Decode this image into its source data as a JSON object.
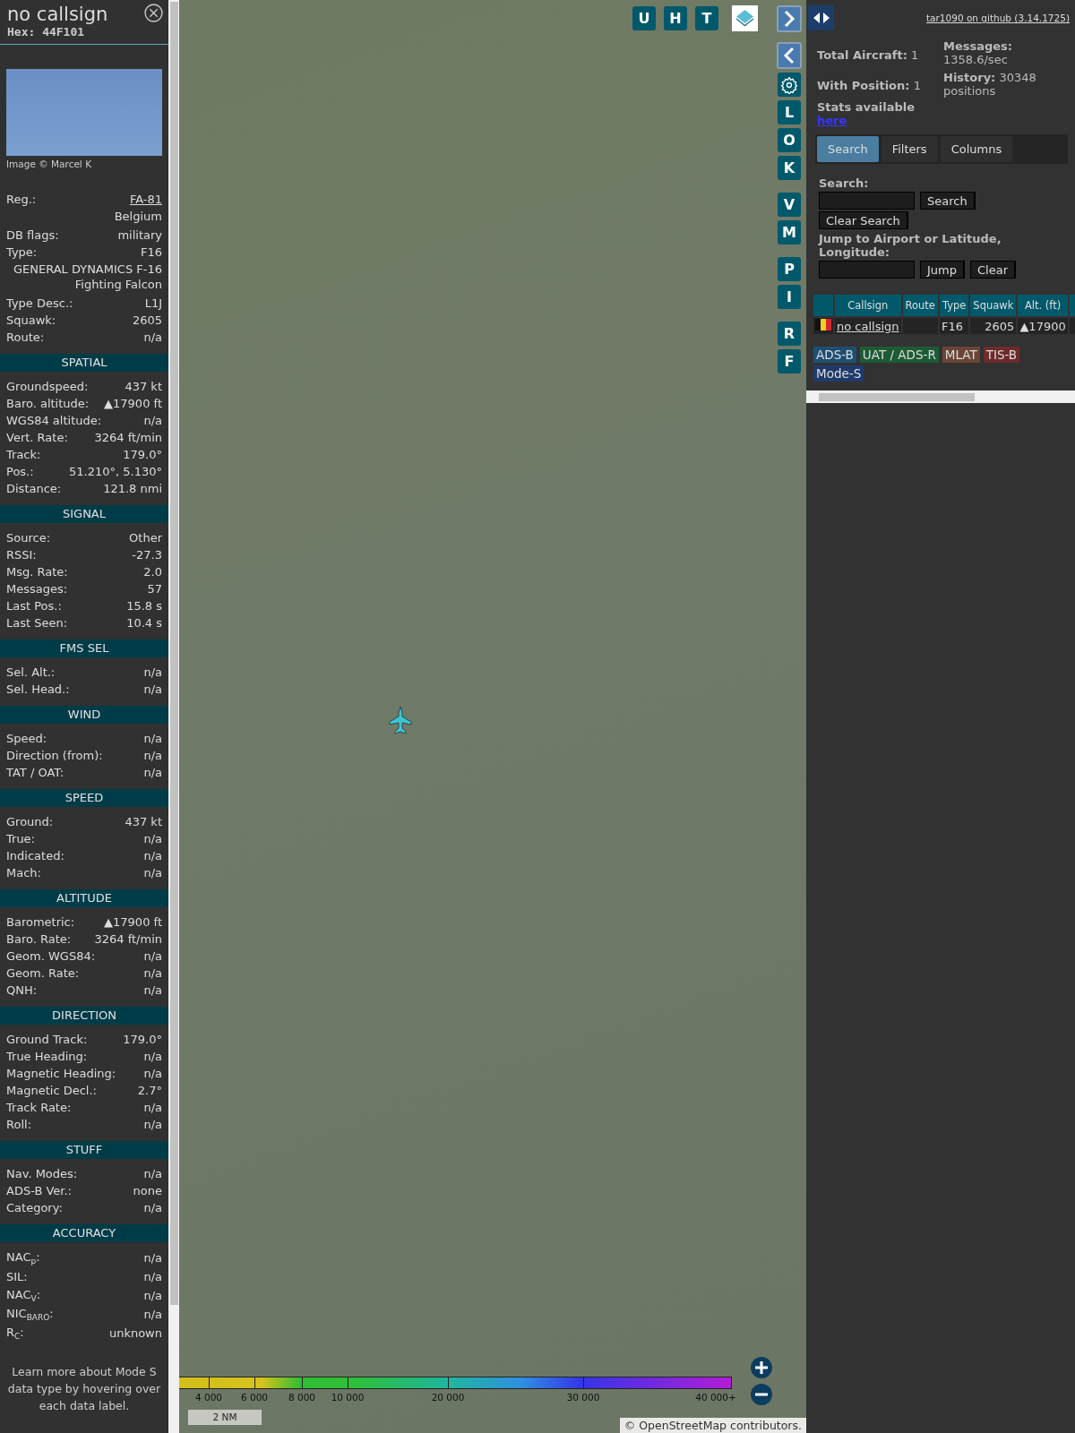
{
  "sidebar": {
    "title": "no callsign",
    "hex": "Hex: 44F101",
    "image_credit": "Image © Marcel K",
    "identity": [
      {
        "kind": "link",
        "label": "Reg.:",
        "value": "FA-81"
      },
      {
        "kind": "value",
        "value": "Belgium"
      },
      {
        "kind": "row",
        "label": "DB flags:",
        "value": "military"
      },
      {
        "kind": "row",
        "label": "Type:",
        "value": "F16"
      },
      {
        "kind": "value",
        "value": "GENERAL DYNAMICS F-16 Fighting Falcon"
      },
      {
        "kind": "row",
        "label": "Type Desc.:",
        "value": "L1J"
      },
      {
        "kind": "row",
        "label": "Squawk:",
        "value": "2605"
      },
      {
        "kind": "row",
        "label": "Route:",
        "value": "n/a"
      }
    ],
    "sections": [
      {
        "title": "SPATIAL",
        "rows": [
          {
            "label": "Groundspeed:",
            "value": "437 kt"
          },
          {
            "label": "Baro. altitude:",
            "value": "▲17900 ft"
          },
          {
            "label": "WGS84 altitude:",
            "value": "n/a"
          },
          {
            "label": "Vert. Rate:",
            "value": "3264 ft/min"
          },
          {
            "label": "Track:",
            "value": "179.0°"
          },
          {
            "label": "Pos.:",
            "value": "51.210°, 5.130°"
          },
          {
            "label": "Distance:",
            "value": "121.8 nmi"
          }
        ]
      },
      {
        "title": "SIGNAL",
        "rows": [
          {
            "label": "Source:",
            "value": "Other"
          },
          {
            "label": "RSSI:",
            "value": "-27.3"
          },
          {
            "label": "Msg. Rate:",
            "value": "2.0"
          },
          {
            "label": "Messages:",
            "value": "57"
          },
          {
            "label": "Last Pos.:",
            "value": "15.8 s"
          },
          {
            "label": "Last Seen:",
            "value": "10.4 s"
          }
        ]
      },
      {
        "title": "FMS SEL",
        "rows": [
          {
            "label": "Sel. Alt.:",
            "value": "n/a"
          },
          {
            "label": "Sel. Head.:",
            "value": "n/a"
          }
        ]
      },
      {
        "title": "WIND",
        "rows": [
          {
            "label": "Speed:",
            "value": "n/a"
          },
          {
            "label": "Direction (from):",
            "value": "n/a"
          },
          {
            "label": "TAT / OAT:",
            "value": "n/a"
          }
        ]
      },
      {
        "title": "SPEED",
        "rows": [
          {
            "label": "Ground:",
            "value": "437 kt"
          },
          {
            "label": "True:",
            "value": "n/a"
          },
          {
            "label": "Indicated:",
            "value": "n/a"
          },
          {
            "label": "Mach:",
            "value": "n/a"
          }
        ]
      },
      {
        "title": "ALTITUDE",
        "rows": [
          {
            "label": "Barometric:",
            "value": "▲17900 ft"
          },
          {
            "label": "Baro. Rate:",
            "value": "3264 ft/min"
          },
          {
            "label": "Geom. WGS84:",
            "value": "n/a"
          },
          {
            "label": "Geom. Rate:",
            "value": "n/a"
          },
          {
            "label": "QNH:",
            "value": "n/a"
          }
        ]
      },
      {
        "title": "DIRECTION",
        "rows": [
          {
            "label": "Ground Track:",
            "value": "179.0°"
          },
          {
            "label": "True Heading:",
            "value": "n/a"
          },
          {
            "label": "Magnetic Heading:",
            "value": "n/a"
          },
          {
            "label": "Magnetic Decl.:",
            "value": "2.7°"
          },
          {
            "label": "Track Rate:",
            "value": "n/a"
          },
          {
            "label": "Roll:",
            "value": "n/a"
          }
        ]
      },
      {
        "title": "STUFF",
        "rows": [
          {
            "label": "Nav. Modes:",
            "value": "n/a"
          },
          {
            "label": "ADS-B Ver.:",
            "value": "none"
          },
          {
            "label": "Category:",
            "value": "n/a"
          }
        ]
      },
      {
        "title": "ACCURACY",
        "rows": [
          {
            "label": "NAC$_{p}$:",
            "value": "n/a"
          },
          {
            "label": "SIL:",
            "value": "n/a"
          },
          {
            "label": "NAC$_{V}$:",
            "value": "n/a"
          },
          {
            "label": "NIC$_{BARO}$:",
            "value": "n/a"
          },
          {
            "label": "R$_{C}$:",
            "value": "unknown"
          }
        ]
      }
    ],
    "footer": "Learn more about Mode S data type by hovering over each data label."
  },
  "map": {
    "top_buttons": [
      "U",
      "H",
      "T"
    ],
    "side_buttons": [
      "L",
      "O",
      "K",
      "V",
      "M",
      "P",
      "I",
      "R",
      "F"
    ],
    "altitude_labels": [
      "4 000",
      "6 000",
      "8 000",
      "10 000",
      "20 000",
      "30 000",
      "40 000+"
    ],
    "scale": "2 NM",
    "attribution": "© OpenStreetMap contributors."
  },
  "panel": {
    "github_link": "tar1090 on github (3.14.1725)",
    "stats_left": [
      "**Total Aircraft:** 1",
      "**With Position:** 1"
    ],
    "stats_available": "Stats available",
    "stats_link": "here",
    "stats_right": [
      "**Messages:** 1358.6/sec",
      "**History:** 30348 positions"
    ],
    "tabs": [
      {
        "label": "Search",
        "selected": true
      },
      {
        "label": "Filters",
        "selected": false
      },
      {
        "label": "Columns",
        "selected": false
      }
    ],
    "search_label": "Search:",
    "search_button": "Search",
    "clear_search_button": "Clear Search",
    "jump_label": "Jump to Airport or Latitude, Longitude:",
    "jump_button": "Jump",
    "clear_button": "Clear",
    "table": {
      "columns": [
        "Callsign",
        "Route",
        "Type",
        "Squawk",
        "Alt. (ft)"
      ],
      "rows": [
        {
          "callsign": "no callsign",
          "type": "F16",
          "squawk": "2605",
          "altitude": "▲17900"
        }
      ]
    },
    "legend": [
      {
        "label": "ADS-B",
        "color": "#1e4f73"
      },
      {
        "label": "UAT / ADS-R",
        "color": "#1d5b35"
      },
      {
        "label": "MLAT",
        "color": "#6a4535"
      },
      {
        "label": "TIS-B",
        "color": "#6e2b2b"
      },
      {
        "label": "Mode-S",
        "color": "#1f3a6b"
      }
    ]
  }
}
